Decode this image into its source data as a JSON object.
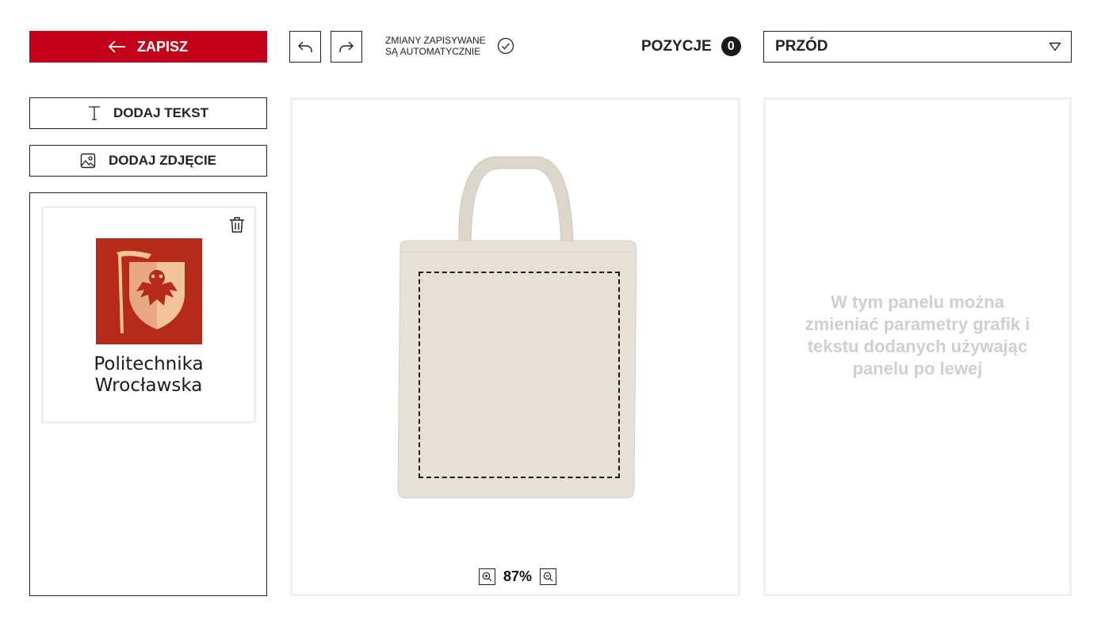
{
  "header": {
    "save_label": "ZAPISZ",
    "autosave_line1": "ZMIANY ZAPISYWANE",
    "autosave_line2": "SĄ AUTOMATYCZNIE",
    "positions_label": "POZYCJE",
    "positions_count": "0",
    "side_select_value": "PRZÓD"
  },
  "tools": {
    "add_text_label": "DODAJ TEKST",
    "add_image_label": "DODAJ ZDJĘCIE"
  },
  "layers": [
    {
      "logo_line1": "Politechnika",
      "logo_line2": "Wrocławska"
    }
  ],
  "canvas": {
    "zoom": "87%"
  },
  "properties": {
    "hint": "W tym panelu można zmieniać parametry grafik i tekstu dodanych używając panelu po lewej"
  },
  "colors": {
    "accent": "#c3001a",
    "logo_red": "#b52a19",
    "bag": "#e6e0d6"
  }
}
